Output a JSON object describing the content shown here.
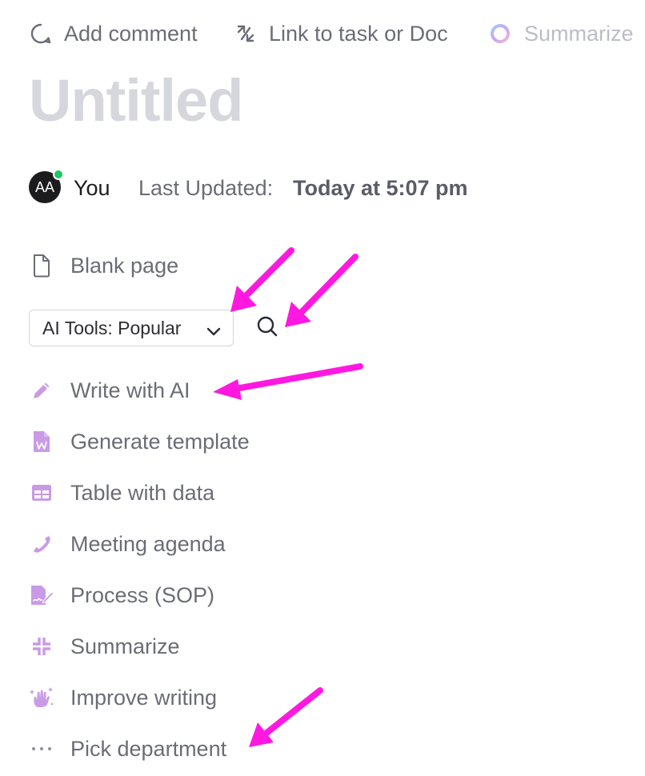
{
  "toolbar": {
    "add_comment": "Add comment",
    "link_task_doc": "Link to task or Doc",
    "summarize": "Summarize"
  },
  "document": {
    "title": "Untitled",
    "author": "You",
    "avatar_initials": "AA",
    "last_updated_label": "Last Updated:",
    "last_updated_value": "Today at 5:07 pm"
  },
  "blank_page": {
    "label": "Blank page",
    "icon": "document-icon"
  },
  "ai_tools": {
    "selected": "AI Tools: Popular",
    "items": [
      {
        "label": "Write with AI",
        "icon": "pencil-icon"
      },
      {
        "label": "Generate template",
        "icon": "word-file-icon"
      },
      {
        "label": "Table with data",
        "icon": "table-icon"
      },
      {
        "label": "Meeting agenda",
        "icon": "phone-icon"
      },
      {
        "label": "Process (SOP)",
        "icon": "signed-document-icon"
      },
      {
        "label": "Summarize",
        "icon": "collapse-icon"
      },
      {
        "label": "Improve writing",
        "icon": "sparkle-hand-icon"
      },
      {
        "label": "Pick department",
        "icon": "more-dots-icon"
      }
    ]
  },
  "colors": {
    "accent_purple": "#c99be6",
    "annotation_magenta": "#ff19e0",
    "text_gray": "#6b6d75",
    "title_gray": "#d6d7dc",
    "online_green": "#1ec768"
  }
}
